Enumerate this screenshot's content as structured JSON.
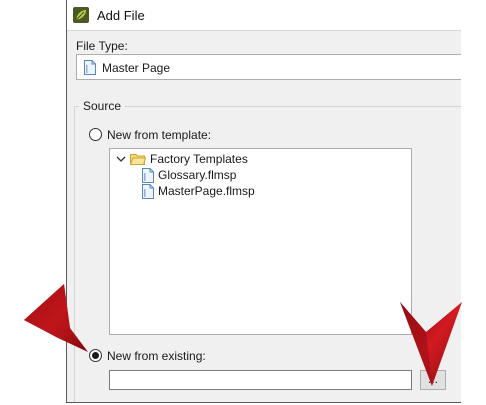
{
  "dialog": {
    "title": "Add File",
    "icon": "flare-leaf-icon"
  },
  "file_type": {
    "label": "File Type:",
    "value": "Master Page"
  },
  "source": {
    "group_label": "Source",
    "option_template": {
      "label": "New from template:",
      "checked": false
    },
    "option_existing": {
      "label": "New from existing:",
      "checked": true
    },
    "tree": {
      "folder": {
        "label": "Factory Templates",
        "expanded": true
      },
      "items": [
        "Glossary.flmsp",
        "MasterPage.flmsp"
      ]
    },
    "existing_path_value": "",
    "browse_label": "..."
  },
  "annotations": {
    "arrow_color": "#c8161d"
  }
}
